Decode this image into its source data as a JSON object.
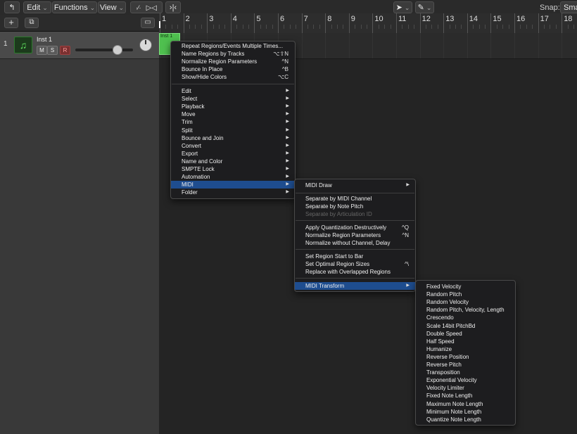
{
  "toolbar": {
    "edit": "Edit",
    "functions": "Functions",
    "view": "View",
    "snap_label": "Snap:",
    "snap_value": "Sma"
  },
  "ruler": [
    "1",
    "2",
    "3",
    "4",
    "5",
    "6",
    "7",
    "8",
    "9",
    "10",
    "11",
    "12",
    "13",
    "14",
    "15",
    "16",
    "17",
    "18"
  ],
  "track": {
    "number": "1",
    "name": "Inst 1",
    "mute": "M",
    "solo": "S",
    "record": "R",
    "volume_level": 0.72
  },
  "region": {
    "name": "Inst 1"
  },
  "context_menu": {
    "items": [
      {
        "label": "Repeat Regions/Events Multiple Times...",
        "shortcut": ""
      },
      {
        "label": "Name Regions by Tracks",
        "shortcut": "⌥⇧N"
      },
      {
        "label": "Normalize Region Parameters",
        "shortcut": "^N"
      },
      {
        "label": "Bounce In Place",
        "shortcut": "^B"
      },
      {
        "label": "Show/Hide Colors",
        "shortcut": "⌥C"
      }
    ],
    "submenus": [
      "Edit",
      "Select",
      "Playback",
      "Move",
      "Trim",
      "Split",
      "Bounce and Join",
      "Convert",
      "Export",
      "Name and Color",
      "SMPTE Lock",
      "Automation",
      "MIDI",
      "Folder"
    ]
  },
  "midi_menu": {
    "draw": "MIDI Draw",
    "group2": [
      {
        "label": "Separate by MIDI Channel",
        "disabled": false
      },
      {
        "label": "Separate by Note Pitch",
        "disabled": false
      },
      {
        "label": "Separate by Articulation ID",
        "disabled": true
      }
    ],
    "group3": [
      {
        "label": "Apply Quantization Destructively",
        "shortcut": "^Q"
      },
      {
        "label": "Normalize Region Parameters",
        "shortcut": "^N"
      },
      {
        "label": "Normalize without Channel, Delay",
        "shortcut": ""
      }
    ],
    "group4": [
      {
        "label": "Set Region Start to Bar",
        "shortcut": ""
      },
      {
        "label": "Set Optimal Region Sizes",
        "shortcut": "^\\"
      },
      {
        "label": "Replace with Overlapped Regions",
        "shortcut": ""
      }
    ],
    "transform": "MIDI Transform"
  },
  "transform_menu": [
    "Fixed Velocity",
    "Random Pitch",
    "Random Velocity",
    "Random Pitch, Velocity, Length",
    "Crescendo",
    "Scale 14bit PitchBd",
    "Double Speed",
    "Half Speed",
    "Humanize",
    "Reverse Position",
    "Reverse Pitch",
    "Transposition",
    "Exponential Velocity",
    "Velocity Limiter",
    "Fixed Note Length",
    "Maximum Note Length",
    "Minimum Note Length",
    "Quantize Note Length"
  ]
}
